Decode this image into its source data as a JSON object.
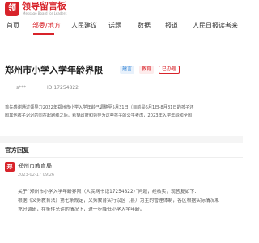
{
  "header": {
    "logo_char": "领",
    "brand": "领导留言板",
    "brand_sub": "Message Board for Leaders"
  },
  "nav": {
    "items": [
      "首页",
      "部委/地方",
      "人民建议",
      "话题",
      "数据",
      "报道",
      "人民日报读者来"
    ]
  },
  "post": {
    "title": "郑州市小学入学年龄界限",
    "tags": [
      "建言",
      "教育",
      "已办理"
    ],
    "author": "s***",
    "id": "ID:17254822",
    "desc_lines": [
      "首先感谢通过领导力2022年郑州市小学入学年龄已调整至5月31日（目前是6月1日-8月31日的孩子还",
      "国其他孩子迟迟的同在起跑线之后。希望政府和领导为这些孩子的公平考虑，2023年入学年龄和全国"
    ]
  },
  "reply": {
    "section_title": "官方回复",
    "icon_char": "郑",
    "org": "郑州市教育局",
    "date": "2023-02-17 09:26",
    "lines": [
      "关于“郑州市小学入学年龄界限（人民网书记17254822）”问题，经核实，现答复如下：",
      "",
      "根据《义务教育法》第七条规定，义务教育实行以区（县）为主的管理体制，各区根据实际情况和",
      "充分调研，在条件允许的情况下，进一步降低小学入学年龄。"
    ]
  },
  "colors": {
    "accent": "#d8232a",
    "tag_blue": "#2a7fd4"
  }
}
